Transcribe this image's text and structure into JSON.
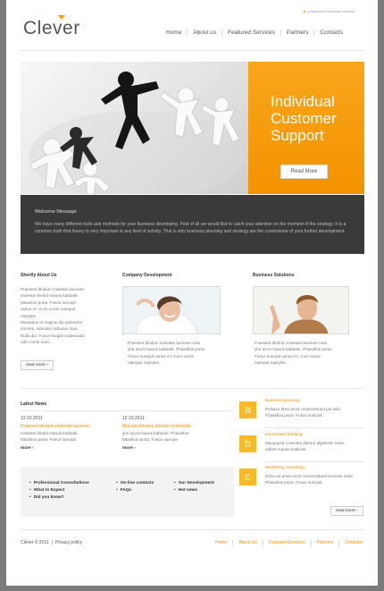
{
  "header": {
    "tagline": "progressive business solution",
    "logo": "Clever",
    "nav": [
      "Home",
      "About us",
      "Featured Services",
      "Partners",
      "Contacts"
    ]
  },
  "banner": {
    "promo_title": "Individual Customer Support",
    "promo_button": "Read More"
  },
  "welcome": {
    "title": "Welcome Message",
    "text": "We have many different tools and methods for your business developing. First of all we would like to catch your attention on the moment of the strategy. It is a common truth that theory is very important in any kind of activity. That is why business planning and strategy are the cornerstone of your further development."
  },
  "columns": [
    {
      "title": "Shortly About Us",
      "lines": [
        "Praesent blndum molestie lacreare",
        "molestie blndrit mauris kabtode.",
        "Mtaolitus porta. Fusce suscipit",
        "varius mi. Cum sociis natoque",
        "naytyles.",
        "Maeatitus et magnis dis parturient",
        "montes, nascetur ridiculus mus.",
        "Nulla dui. Fusce feugiat malesuada",
        "odio.morbi nunc."
      ],
      "button": "read more"
    },
    {
      "title": "Company Development",
      "lines": [
        "Praesent blndum molestie lacreare mas",
        "yhe arcet mauris kabtode. Phasellus porta.",
        "Fusce suscipit varius mi. Cum sociis",
        "natoque naytyles."
      ]
    },
    {
      "title": "Business Solutions",
      "lines": [
        "Praesent blndum molestie lacreare mas",
        "yhe arcet mauris kabtode. Phasellus porta.",
        "Fusce suscipit varius mi. Cum sociis",
        "natoque naytyles."
      ]
    }
  ],
  "news": {
    "title": "Latest News",
    "items": [
      {
        "date": "12.10.2011",
        "link": "Praesent blndum molestie lacreare",
        "lines": [
          "molestie blndrit mauris kabtode.",
          "Mtaolitus porta. Fusce suscipit"
        ],
        "more": "more"
      },
      {
        "date": "12.10.2011",
        "link": "Maeatis blndum dolobis molestode",
        "lines": [
          "yhe arcet mauris kabtode. Phasellus",
          "Mtaolitus porta. Fusce suscipit"
        ],
        "more": "more"
      }
    ]
  },
  "link_list": {
    "col1": [
      "Professional Consultations",
      "What to Expect",
      "Did you know?"
    ],
    "col2": [
      "On-line contacts",
      "FAQs"
    ],
    "col3": [
      "Our Development",
      "Hot news"
    ]
  },
  "features": [
    {
      "letter": "a",
      "title": "Business planning",
      "lines": [
        "Pelsace drea arcet consectetued pis odio",
        "Phasellus porta. Fusce suscipit."
      ]
    },
    {
      "letter": "b",
      "title": "Investment banking",
      "lines": [
        "Mauyqued cnsectey dlorum dignissim noiss",
        "dolbnt mauris kabtode."
      ]
    },
    {
      "letter": "c",
      "title": "Marketing consulting",
      "lines": [
        "Donn ad amet arcet consectetued lacreate varia",
        "Phasellus porta. Fusce suscipit."
      ]
    }
  ],
  "features_button": "read more",
  "footer": {
    "copyright": "Clever © 2011",
    "privacy": "Privacy policy",
    "nav": [
      "Home",
      "About Us",
      "Featured Services",
      "Partners",
      "Contacts"
    ]
  },
  "colors": {
    "accent": "#f39300",
    "dark_panel": "#3a3a3a",
    "square": "#f9b928"
  }
}
